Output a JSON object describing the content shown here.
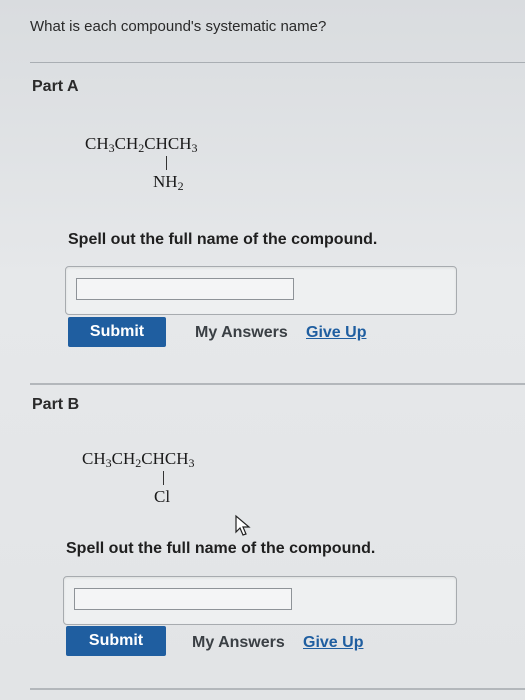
{
  "question": "What is each compound's systematic name?",
  "parts": [
    {
      "title": "Part A",
      "formula": {
        "main": "CH3CH2CHCH3",
        "substituent": "NH2"
      },
      "instruction": "Spell out the full name of the compound.",
      "answer_value": "",
      "submit_label": "Submit",
      "my_answers_label": "My Answers",
      "give_up_label": "Give Up"
    },
    {
      "title": "Part B",
      "formula": {
        "main": "CH3CH2CHCH3",
        "substituent": "Cl"
      },
      "instruction": "Spell out the full name of the compound.",
      "answer_value": "",
      "submit_label": "Submit",
      "my_answers_label": "My Answers",
      "give_up_label": "Give Up"
    }
  ],
  "colors": {
    "submit_bg": "#1f5ea0",
    "link": "#1f5ea0"
  }
}
